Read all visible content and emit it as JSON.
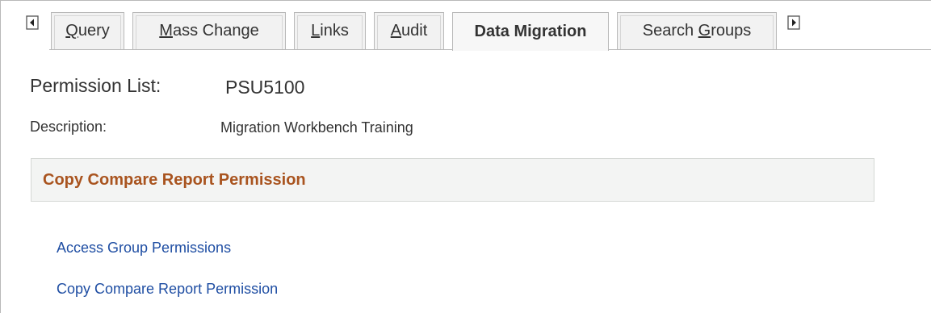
{
  "tabs": {
    "scroll_left_icon": "triangle-left-icon",
    "scroll_right_icon": "triangle-right-icon",
    "items": [
      {
        "key": "query",
        "pre": "",
        "accel": "Q",
        "post": "uery",
        "active": false
      },
      {
        "key": "mass",
        "pre": "",
        "accel": "M",
        "post": "ass Change",
        "active": false
      },
      {
        "key": "links",
        "pre": "",
        "accel": "L",
        "post": "inks",
        "active": false
      },
      {
        "key": "audit",
        "pre": "",
        "accel": "A",
        "post": "udit",
        "active": true
      },
      {
        "key": "data",
        "label": "Data Migration",
        "active": true
      },
      {
        "key": "search",
        "pre": "Search ",
        "accel": "G",
        "post": "roups",
        "active": false
      }
    ]
  },
  "header": {
    "permission_list_label": "Permission List:",
    "permission_list_value": "PSU5100",
    "description_label": "Description:",
    "description_value": "Migration Workbench Training"
  },
  "section": {
    "title": "Copy Compare Report Permission"
  },
  "links": [
    {
      "label": "Access Group Permissions"
    },
    {
      "label": "Copy Compare Report Permission"
    }
  ],
  "colors": {
    "section_title": "#a9541f",
    "link": "#1f4ea3",
    "tab_border": "#b9b9b9"
  }
}
